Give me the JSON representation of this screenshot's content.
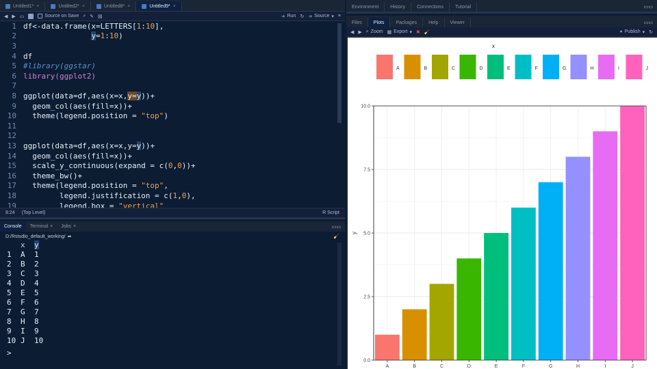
{
  "editor": {
    "tabs": [
      {
        "label": "Untitled1*"
      },
      {
        "label": "Untitled2*"
      },
      {
        "label": "Untitled8*"
      },
      {
        "label": "Untitled9*"
      }
    ],
    "toolbar": {
      "source_on_save": "Source on Save",
      "run": "Run",
      "source": "Source"
    },
    "lines": [
      {
        "n": "1",
        "parts": [
          {
            "t": "df<-data.frame(x=LETTERS[",
            "c": "code"
          },
          {
            "t": "1",
            "c": "kw-num"
          },
          {
            "t": ":",
            "c": "code"
          },
          {
            "t": "10",
            "c": "kw-num"
          },
          {
            "t": "],",
            "c": "code"
          }
        ]
      },
      {
        "n": "2",
        "parts": [
          {
            "t": "               ",
            "c": "code"
          },
          {
            "t": "y",
            "c": "code sel"
          },
          {
            "t": "=",
            "c": "code"
          },
          {
            "t": "1",
            "c": "kw-num"
          },
          {
            "t": ":",
            "c": "code"
          },
          {
            "t": "10",
            "c": "kw-num"
          },
          {
            "t": ")",
            "c": "code"
          }
        ]
      },
      {
        "n": "3",
        "parts": []
      },
      {
        "n": "4",
        "parts": [
          {
            "t": "df",
            "c": "code"
          }
        ]
      },
      {
        "n": "5",
        "parts": [
          {
            "t": "#library(ggstar)",
            "c": "kw-com"
          }
        ]
      },
      {
        "n": "6",
        "parts": [
          {
            "t": "library(ggplot2)",
            "c": "kw-pink"
          }
        ]
      },
      {
        "n": "7",
        "parts": []
      },
      {
        "n": "8",
        "parts": [
          {
            "t": "ggplot(data=df,aes(x=x,",
            "c": "code"
          },
          {
            "t": "y=",
            "c": "code hl"
          },
          {
            "t": "y",
            "c": "code sel"
          },
          {
            "t": "))+",
            "c": "code"
          }
        ]
      },
      {
        "n": "9",
        "parts": [
          {
            "t": "  geom_col(aes(fill=x))+",
            "c": "code"
          }
        ]
      },
      {
        "n": "10",
        "parts": [
          {
            "t": "  theme(legend.position = ",
            "c": "code"
          },
          {
            "t": "\"top\"",
            "c": "kw-str"
          },
          {
            "t": ")",
            "c": "code"
          }
        ]
      },
      {
        "n": "11",
        "parts": []
      },
      {
        "n": "12",
        "parts": []
      },
      {
        "n": "13",
        "parts": [
          {
            "t": "ggplot(data=df,aes(x=x,",
            "c": "code"
          },
          {
            "t": "y=",
            "c": "code"
          },
          {
            "t": "y",
            "c": "code sel"
          },
          {
            "t": "))+",
            "c": "code"
          }
        ]
      },
      {
        "n": "14",
        "parts": [
          {
            "t": "  geom_col(aes(fill=x))+",
            "c": "code"
          }
        ]
      },
      {
        "n": "15",
        "parts": [
          {
            "t": "  scale_y_continuous(expand = c(",
            "c": "code"
          },
          {
            "t": "0",
            "c": "kw-num"
          },
          {
            "t": ",",
            "c": "code"
          },
          {
            "t": "0",
            "c": "kw-num"
          },
          {
            "t": "))+",
            "c": "code"
          }
        ]
      },
      {
        "n": "16",
        "parts": [
          {
            "t": "  theme_bw()+",
            "c": "code"
          }
        ]
      },
      {
        "n": "17",
        "parts": [
          {
            "t": "  theme(legend.position = ",
            "c": "code"
          },
          {
            "t": "\"top\"",
            "c": "kw-str"
          },
          {
            "t": ",",
            "c": "code"
          }
        ]
      },
      {
        "n": "18",
        "parts": [
          {
            "t": "        legend.justification = c(",
            "c": "code"
          },
          {
            "t": "1",
            "c": "kw-num"
          },
          {
            "t": ",",
            "c": "code"
          },
          {
            "t": "0",
            "c": "kw-num"
          },
          {
            "t": "),",
            "c": "code"
          }
        ]
      },
      {
        "n": "19",
        "parts": [
          {
            "t": "        legend.box = ",
            "c": "code"
          },
          {
            "t": "\"vertical\"",
            "c": "kw-str"
          }
        ]
      }
    ],
    "status": {
      "position": "8:24",
      "scope": "(Top Level)",
      "filetype": "R Script"
    }
  },
  "console": {
    "tabs": [
      {
        "label": "Console"
      },
      {
        "label": "Terminal"
      },
      {
        "label": "Jobs"
      }
    ],
    "path": "D:/Rstudio_default_working/",
    "header": {
      "x": "x",
      "y": "y"
    },
    "rows": [
      {
        "i": "1",
        "x": "A",
        "y": "1"
      },
      {
        "i": "2",
        "x": "B",
        "y": "2"
      },
      {
        "i": "3",
        "x": "C",
        "y": "3"
      },
      {
        "i": "4",
        "x": "D",
        "y": "4"
      },
      {
        "i": "5",
        "x": "E",
        "y": "5"
      },
      {
        "i": "6",
        "x": "F",
        "y": "6"
      },
      {
        "i": "7",
        "x": "G",
        "y": "7"
      },
      {
        "i": "8",
        "x": "H",
        "y": "8"
      },
      {
        "i": "9",
        "x": "I",
        "y": "9"
      },
      {
        "i": "10",
        "x": "J",
        "y": "10"
      }
    ]
  },
  "env_tabs": [
    {
      "label": "Environment"
    },
    {
      "label": "History"
    },
    {
      "label": "Connections"
    },
    {
      "label": "Tutorial"
    }
  ],
  "files_tabs": [
    {
      "label": "Files"
    },
    {
      "label": "Plots"
    },
    {
      "label": "Packages"
    },
    {
      "label": "Help"
    },
    {
      "label": "Viewer"
    }
  ],
  "plots_toolbar": {
    "zoom": "Zoom",
    "export": "Export",
    "publish": "Publish"
  },
  "colors": {
    "bg": "#0b1c33",
    "panel": "#1a2536",
    "accent": "#24466e"
  },
  "chart_data": {
    "type": "bar",
    "categories": [
      "A",
      "B",
      "C",
      "D",
      "E",
      "F",
      "G",
      "H",
      "I",
      "J"
    ],
    "values": [
      1,
      2,
      3,
      4,
      5,
      6,
      7,
      8,
      9,
      10
    ],
    "colors": [
      "#F8766D",
      "#D89000",
      "#A3A500",
      "#39B600",
      "#00BF7D",
      "#00BFC4",
      "#00B0F6",
      "#9590FF",
      "#E76BF3",
      "#FF62BC"
    ],
    "legend_title": "x",
    "legend_position": "top",
    "ylabel": "y",
    "xlabel": "",
    "ylim": [
      0,
      10
    ],
    "yticks": [
      "0.0",
      "2.5",
      "5.0",
      "7.5",
      "10.0"
    ],
    "ytick_values": [
      0,
      2.5,
      5,
      7.5,
      10
    ],
    "grid": true
  }
}
